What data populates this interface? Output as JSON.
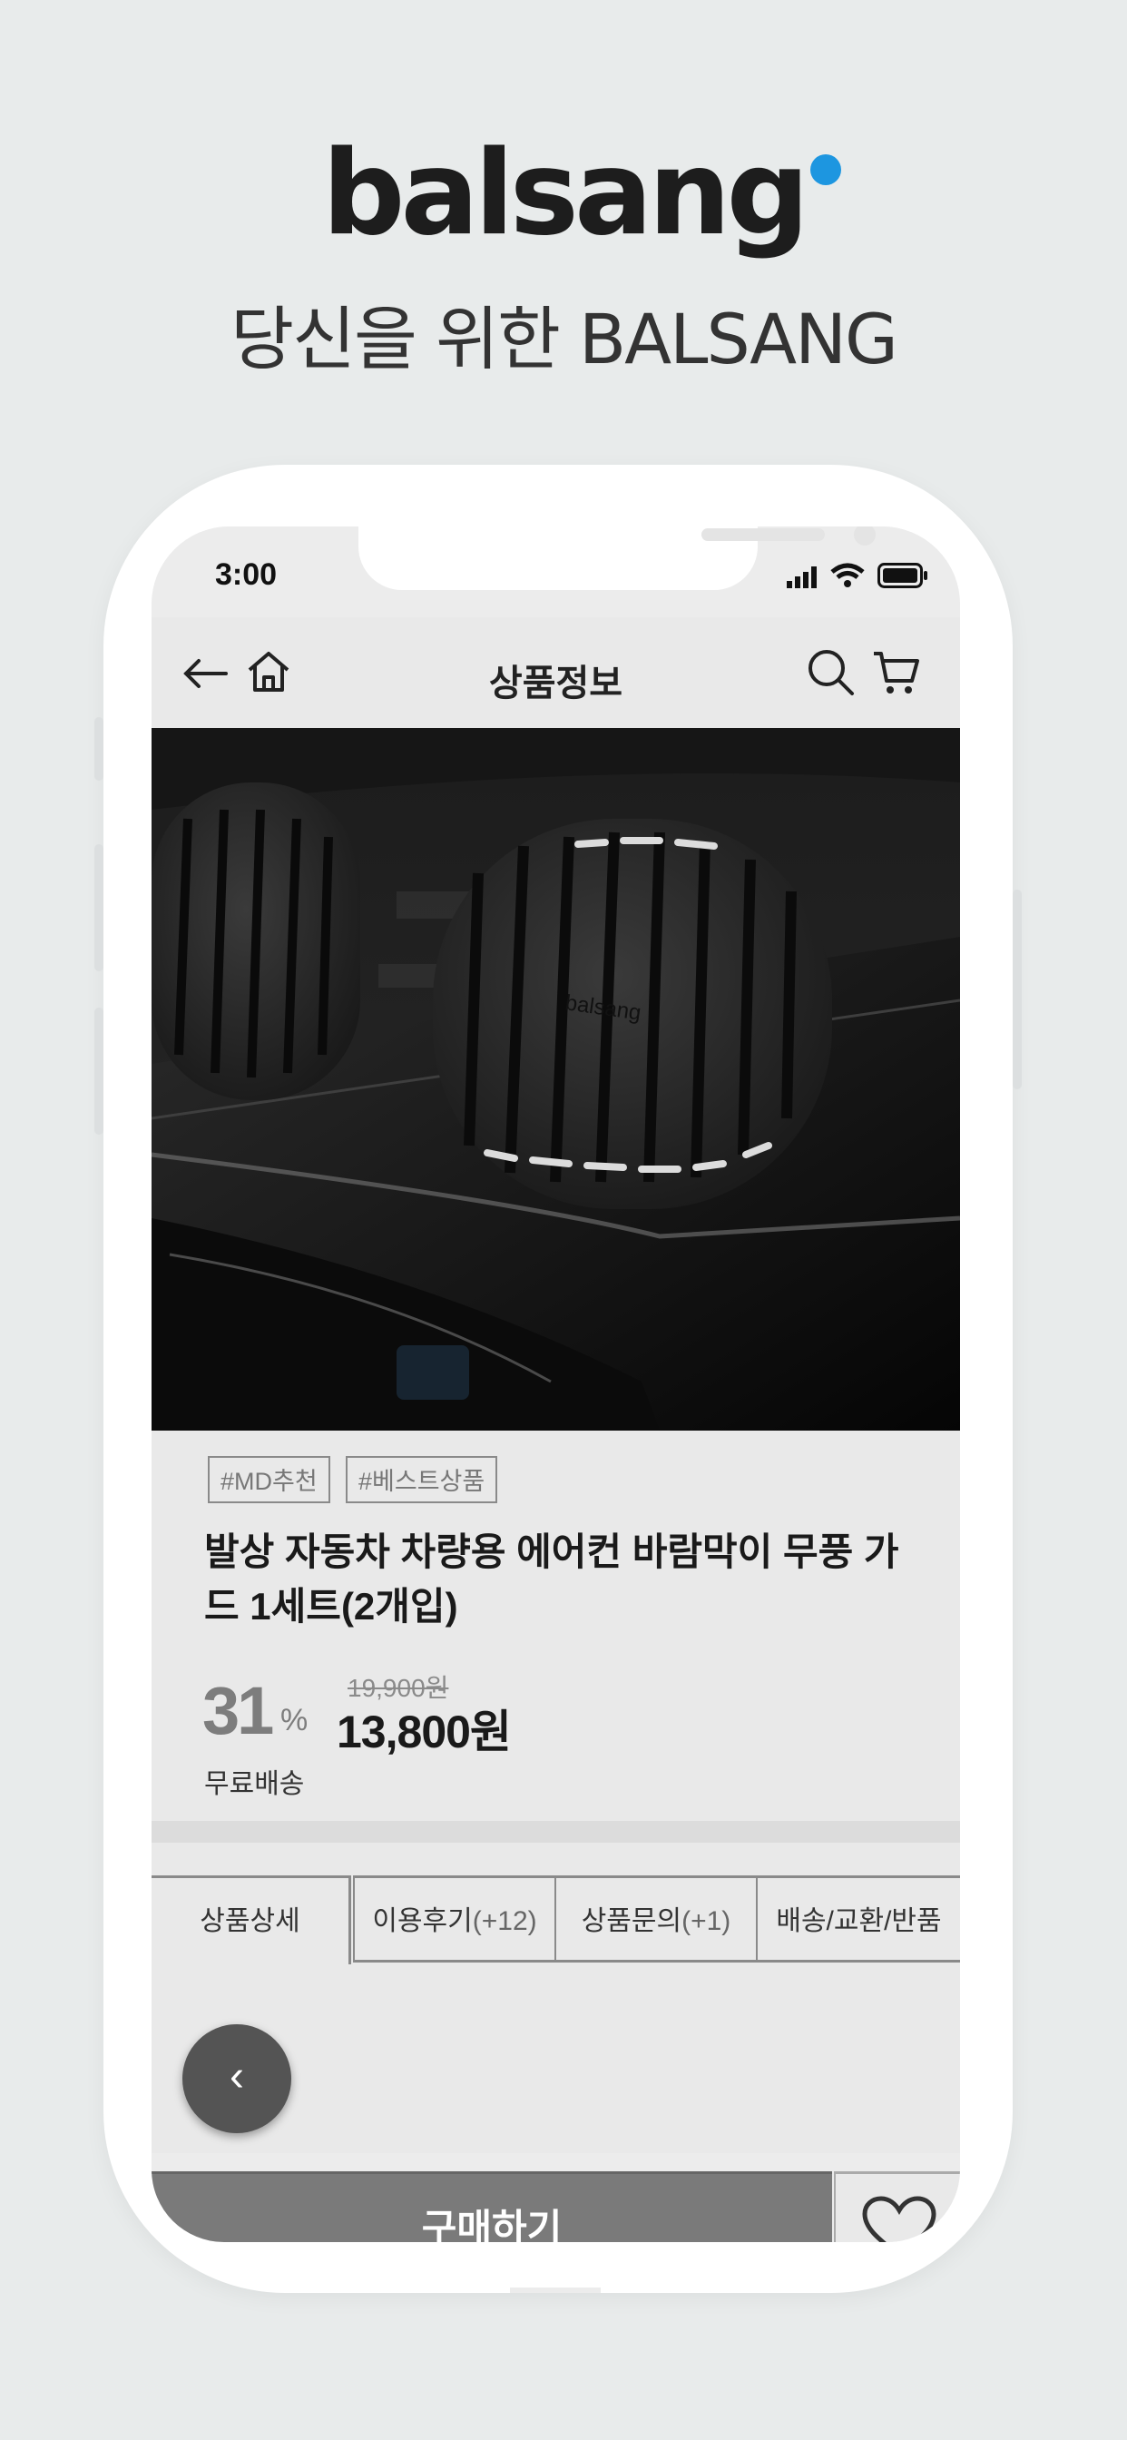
{
  "brand": {
    "logo_text": "balsang",
    "tagline": "당신을 위한 BALSANG",
    "accent_color": "#1d96e0"
  },
  "status_bar": {
    "time": "3:00",
    "icons": [
      "signal-icon",
      "wifi-icon",
      "battery-icon"
    ]
  },
  "nav": {
    "title": "상품정보",
    "left_icons": [
      "back-arrow-icon",
      "home-icon"
    ],
    "right_icons": [
      "search-icon",
      "cart-icon"
    ]
  },
  "product": {
    "image_subject": "air-vent-clip-icon",
    "image_logo_text": "balsang",
    "tags": [
      "#MD추천",
      "#베스트상품"
    ],
    "title": "발상 자동차 차량용 에어컨 바람막이 무풍 가드 1세트(2개입)",
    "discount": "31",
    "discount_unit": "%",
    "original_price": "19,900원",
    "sale_price": "13,800원",
    "shipping": "무료배송"
  },
  "tabs": [
    {
      "label": "상품상세",
      "count": "",
      "active": true
    },
    {
      "label": "이용후기",
      "count": "(+12)",
      "active": false
    },
    {
      "label": "상품문의",
      "count": "(+1)",
      "active": false
    },
    {
      "label": "배송/교환/반품",
      "count": "",
      "active": false
    }
  ],
  "floating": {
    "back_label": "‹"
  },
  "bottom_bar": {
    "buy_label": "구매하기",
    "wish_icon": "heart-icon"
  }
}
